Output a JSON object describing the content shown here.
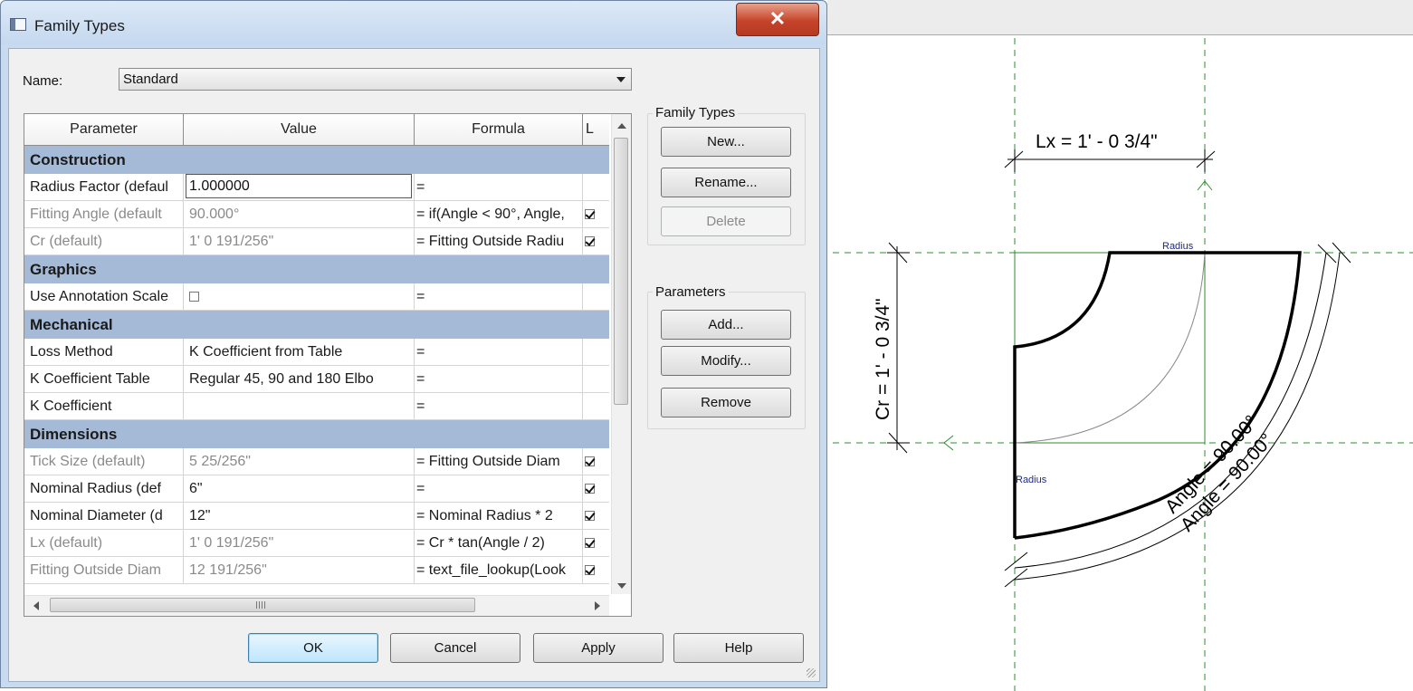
{
  "dialog": {
    "title": "Family Types",
    "close_label": "✕",
    "name_label": "Name:",
    "name_value": "Standard",
    "columns": [
      "Parameter",
      "Value",
      "Formula",
      "L"
    ],
    "groups": [
      {
        "label": "Construction",
        "rows": [
          {
            "param": "Radius Factor (defaul",
            "value": "1.000000",
            "formula": "=",
            "lock": null,
            "editing": true,
            "dim": false
          },
          {
            "param": "Fitting Angle (default",
            "value": "90.000°",
            "formula": "= if(Angle < 90°, Angle,",
            "lock": true,
            "editing": false,
            "dim": true
          },
          {
            "param": "Cr (default)",
            "value": "1'  0 191/256\"",
            "formula": "= Fitting Outside Radiu",
            "lock": true,
            "editing": false,
            "dim": true
          }
        ]
      },
      {
        "label": "Graphics",
        "rows": [
          {
            "param": "Use Annotation Scale",
            "value": "",
            "value_checkbox": false,
            "formula": "=",
            "lock": null,
            "editing": false,
            "dim": false
          }
        ]
      },
      {
        "label": "Mechanical",
        "rows": [
          {
            "param": "Loss Method",
            "value": "K Coefficient from Table",
            "formula": "=",
            "lock": null,
            "editing": false,
            "dim": false
          },
          {
            "param": "K Coefficient Table",
            "value": "Regular 45, 90 and 180 Elbo",
            "formula": "=",
            "lock": null,
            "editing": false,
            "dim": false
          },
          {
            "param": "K Coefficient",
            "value": "",
            "formula": "=",
            "lock": null,
            "editing": false,
            "dim": false
          }
        ]
      },
      {
        "label": "Dimensions",
        "rows": [
          {
            "param": "Tick Size (default)",
            "value": "5 25/256\"",
            "formula": "= Fitting Outside Diam",
            "lock": true,
            "editing": false,
            "dim": true
          },
          {
            "param": "Nominal Radius (def",
            "value": "6\"",
            "formula": "=",
            "lock": true,
            "editing": false,
            "dim": false
          },
          {
            "param": "Nominal Diameter (d",
            "value": "12\"",
            "formula": "= Nominal Radius * 2",
            "lock": true,
            "editing": false,
            "dim": false
          },
          {
            "param": "Lx (default)",
            "value": "1'  0 191/256\"",
            "formula": "= Cr * tan(Angle / 2)",
            "lock": true,
            "editing": false,
            "dim": true
          },
          {
            "param": "Fitting Outside Diam",
            "value": "12 191/256\"",
            "formula": "= text_file_lookup(Look",
            "lock": true,
            "editing": false,
            "dim": true
          }
        ]
      }
    ],
    "family_types": {
      "title": "Family Types",
      "new": "New...",
      "rename": "Rename...",
      "delete": "Delete"
    },
    "parameters": {
      "title": "Parameters",
      "add": "Add...",
      "modify": "Modify...",
      "remove": "Remove"
    },
    "footer": {
      "ok": "OK",
      "cancel": "Cancel",
      "apply": "Apply",
      "help": "Help"
    }
  },
  "drawing": {
    "lx_label": "Lx = 1' - 0 3/4\"",
    "cr_label": "Cr = 1' - 0 3/4\"",
    "radius_top": "Radius",
    "radius_left": "Radius",
    "angle_inner": "Angle = 90.00°",
    "angle_outer": "Angle = 90.00°",
    "colors": {
      "ref_plane": "#1a8a1a",
      "ref_line": "#2f9a2f",
      "geometry": "#000000",
      "label_blue": "#1a2a8a"
    }
  }
}
